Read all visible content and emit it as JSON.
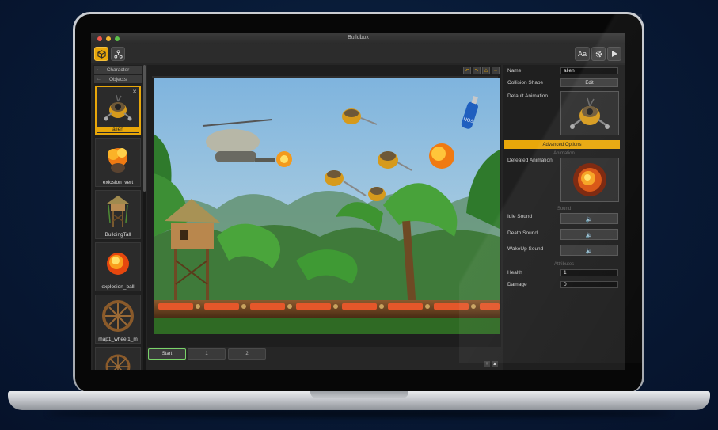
{
  "window": {
    "title": "Buildbox"
  },
  "toolbar": {
    "left_icons": [
      "cube-icon",
      "nodes-icon"
    ],
    "font_button": "Aa",
    "settings_icon": "gear-icon",
    "play_icon": "play-icon"
  },
  "left_panel": {
    "tabs": [
      "Character",
      "Objects"
    ],
    "items": [
      {
        "label": "alien",
        "icon": "alien-robot-icon",
        "selected": true
      },
      {
        "label": "exlosion_vert",
        "icon": "explosion-icon"
      },
      {
        "label": "BuildingTall",
        "icon": "tower-icon"
      },
      {
        "label": "explosion_ball",
        "icon": "explosion-icon"
      },
      {
        "label": "map1_wheel1_m",
        "icon": "wheel-icon"
      },
      {
        "label": "",
        "icon": "wheel-icon"
      }
    ]
  },
  "canvas": {
    "tool_icons": [
      "rotate-left-icon",
      "rotate-right-icon",
      "warning-icon",
      "arrow-right-icon"
    ],
    "scene": "jungle",
    "bottle_text": "NOS"
  },
  "world_tabs": [
    "Start",
    "1",
    "2"
  ],
  "bottom_icons": [
    "plus-icon",
    "up-icon"
  ],
  "properties": {
    "name_label": "Name",
    "name_value": "alien",
    "collision_label": "Collision Shape",
    "collision_button": "Edit",
    "default_anim_label": "Default Animation",
    "advanced_button": "Advanced Options",
    "animation_section": "Animation",
    "defeated_anim_label": "Defeated Animation",
    "sound_section": "Sound",
    "idle_sound_label": "Idle Sound",
    "death_sound_label": "Death Sound",
    "wakeup_sound_label": "WakeUp Sound",
    "attributes_section": "Attributes",
    "health_label": "Health",
    "health_value": "1",
    "damage_label": "Damage",
    "damage_value": "0"
  },
  "colors": {
    "accent": "#e8a70a",
    "panel": "#262626",
    "active_tab_border": "#7ad36a"
  }
}
